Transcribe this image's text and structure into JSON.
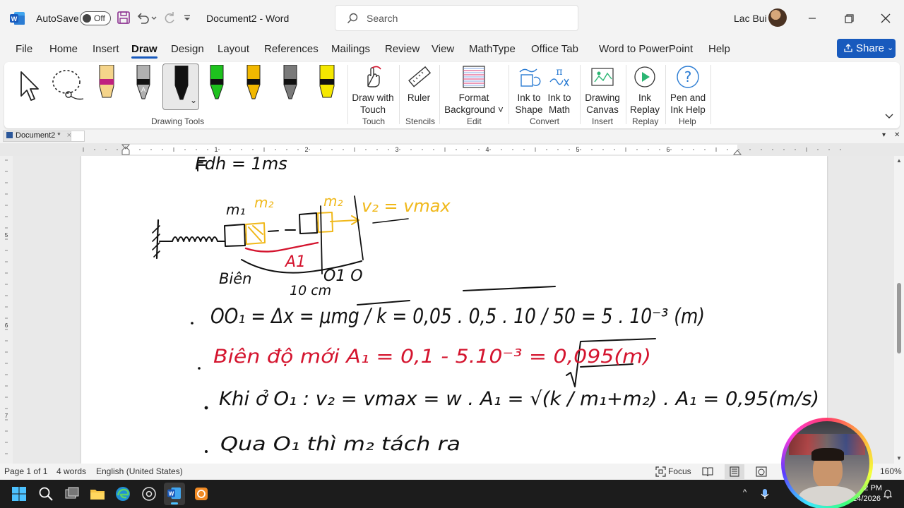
{
  "titlebar": {
    "autosave_label": "AutoSave",
    "toggle_state": "Off",
    "doc_title": "Document2  -  Word",
    "search_placeholder": "Search",
    "user_name": "Lac Bui"
  },
  "tabs": [
    {
      "label": "File"
    },
    {
      "label": "Home"
    },
    {
      "label": "Insert"
    },
    {
      "label": "Draw",
      "active": true
    },
    {
      "label": "Design"
    },
    {
      "label": "Layout"
    },
    {
      "label": "References"
    },
    {
      "label": "Mailings"
    },
    {
      "label": "Review"
    },
    {
      "label": "View"
    },
    {
      "label": "MathType"
    },
    {
      "label": "Office Tab"
    },
    {
      "label": "Word to PowerPoint"
    },
    {
      "label": "Help"
    }
  ],
  "share_label": "Share",
  "ribbon": {
    "drawing_tools_label": "Drawing Tools",
    "draw_with_touch": "Draw with\nTouch",
    "touch_label": "Touch",
    "ruler": "Ruler",
    "stencils_label": "Stencils",
    "format_background": "Format\nBackground ˅",
    "edit_label": "Edit",
    "ink_to_shape": "Ink to\nShape",
    "ink_to_math": "Ink to\nMath",
    "convert_label": "Convert",
    "drawing_canvas": "Drawing\nCanvas",
    "insert_label": "Insert",
    "ink_replay": "Ink\nReplay",
    "replay_label": "Replay",
    "pen_and_ink_help": "Pen and\nInk Help",
    "help_label": "Help",
    "pen_colors": [
      "#f5d48a",
      "#b0b0b0",
      "#111111",
      "#1ec21e",
      "#f2b800",
      "#7a7a7a",
      "#f5e800"
    ]
  },
  "doc_tab": "Document2 *",
  "ruler_numbers": [
    "1",
    "2",
    "3",
    "4",
    "5",
    "6"
  ],
  "vruler_numbers": [
    "5",
    "6",
    "7"
  ],
  "status": {
    "page": "Page 1 of 1",
    "words": "4 words",
    "language": "English (United States)",
    "focus": "Focus",
    "zoom": "160%"
  },
  "taskbar": {
    "time": "3:32 PM",
    "date": "7/24/2026"
  },
  "ink": {
    "top_fragment": "Fdh = 1ms",
    "m1": "m₁",
    "m2_a": "m₂",
    "m2_b": "m₂",
    "v2_vmax": "v₂ = vmax",
    "a1": "A1",
    "bien": "Biên",
    "o1o": "O1 O",
    "ten_cm": "10 cm",
    "line1": "OO₁ = Δx = μmg / k = 0,05 . 0,5 . 10 / 50 = 5 . 10⁻³ (m)",
    "line2": "Biên độ mới A₁ = 0,1 - 5.10⁻³ = 0,095(m)",
    "line3": "Khi ở O₁ : v₂ = vmax = w . A₁ = √(k / m₁+m₂) . A₁ = 0,95(m/s)",
    "line4": "Qua O₁ thì m₂ tách ra"
  },
  "colors": {
    "word_blue": "#185abd",
    "ink_black": "#111111",
    "ink_red": "#d4142e",
    "ink_yellow": "#f0b81a"
  }
}
